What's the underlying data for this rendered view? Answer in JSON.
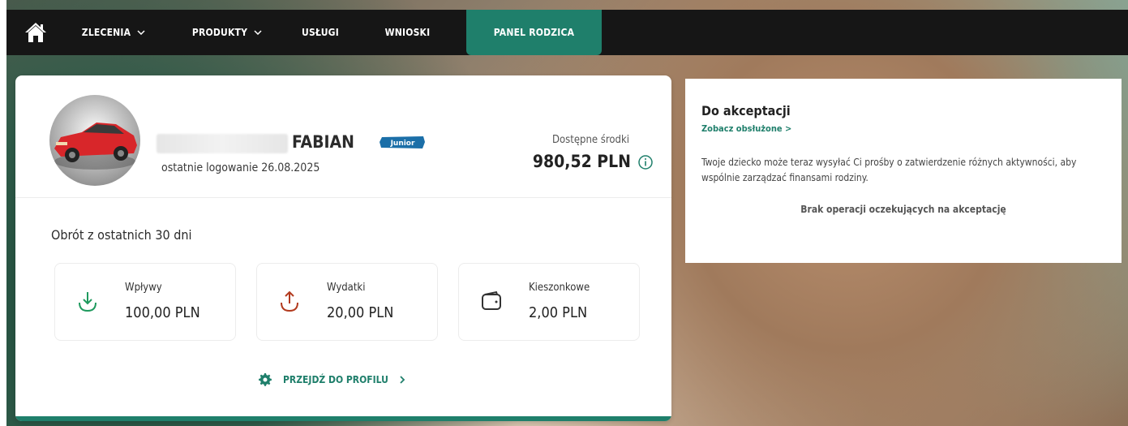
{
  "nav": {
    "home_icon": "home-icon",
    "items": [
      {
        "label": "ZLECENIA",
        "has_chevron": true
      },
      {
        "label": "PRODUKTY",
        "has_chevron": true
      },
      {
        "label": "USŁUGI",
        "has_chevron": false
      },
      {
        "label": "WNIOSKI",
        "has_chevron": false
      },
      {
        "label": "PANEL RODZICA",
        "has_chevron": false,
        "active": true
      }
    ]
  },
  "child": {
    "name": "FABIAN",
    "badge": "Junior",
    "last_login": "ostatnie logowanie 26.08.2025",
    "funds_label": "Dostępne środki",
    "funds_value": "980,52 PLN"
  },
  "turnover": {
    "title": "Obrót z ostatnich 30 dni",
    "stats": [
      {
        "label": "Wpływy",
        "value": "100,00 PLN",
        "icon": "arrow-down-icon"
      },
      {
        "label": "Wydatki",
        "value": "20,00 PLN",
        "icon": "arrow-up-icon"
      },
      {
        "label": "Kieszonkowe",
        "value": "2,00 PLN",
        "icon": "wallet-icon"
      }
    ]
  },
  "profile_link": {
    "label": "PRZEJDŹ DO PROFILU",
    "icon": "gear-icon"
  },
  "approval": {
    "title": "Do akceptacji",
    "link": "Zobacz obsłużone >",
    "description": "Twoje dziecko może teraz wysyłać Ci prośby o zatwierdzenie różnych aktywności, aby wspólnie zarządzać finansami rodziny.",
    "empty": "Brak operacji oczekujących na akceptację"
  },
  "colors": {
    "accent": "#1f7f6b",
    "navbar": "#161616",
    "income": "#1f9a5e",
    "expense": "#b23a1e"
  }
}
